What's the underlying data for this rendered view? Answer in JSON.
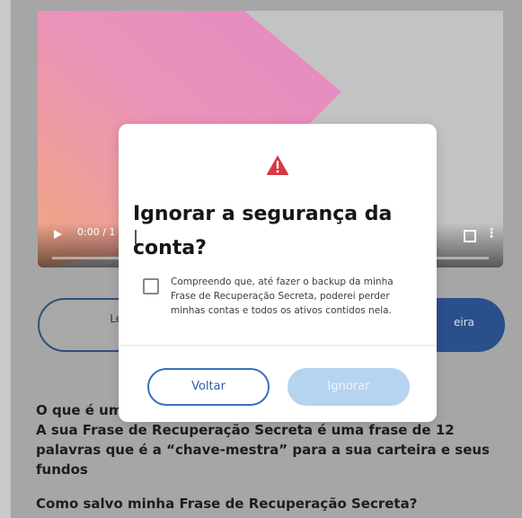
{
  "video": {
    "time_label": "0:00 / 1",
    "play_icon": "play-icon",
    "fullscreen_icon": "fullscreen-icon",
    "more_icon": "more-options-icon",
    "colors": {
      "pink": "#e58ac4",
      "orange": "#f0a880",
      "gray": "#c3c3c3"
    }
  },
  "background": {
    "left_button_label_line1": "Lembre-",
    "left_button_label_line2": "re",
    "right_button_label": "eira",
    "text_line1_partial": "O que é um",
    "text_line2": "A sua Frase de Recuperação Secreta é uma frase de 12",
    "text_line3": "palavras que é a “chave-mestra” para a sua carteira e seus",
    "text_line4": "fundos",
    "text_line5": "Como salvo minha Frase de Recuperação Secreta?"
  },
  "modal": {
    "alert_icon": "warning-icon",
    "title": "Ignorar a segurança da conta?",
    "checkbox_label": "Compreendo que, até fazer o backup da minha Frase de Recuperação Secreta, poderei perder minhas contas e todos os ativos contidos nela.",
    "back_button": "Voltar",
    "ignore_button": "Ignorar",
    "colors": {
      "alert": "#d73847",
      "primary": "#3670bd",
      "disabled": "#b6d3ef"
    }
  }
}
